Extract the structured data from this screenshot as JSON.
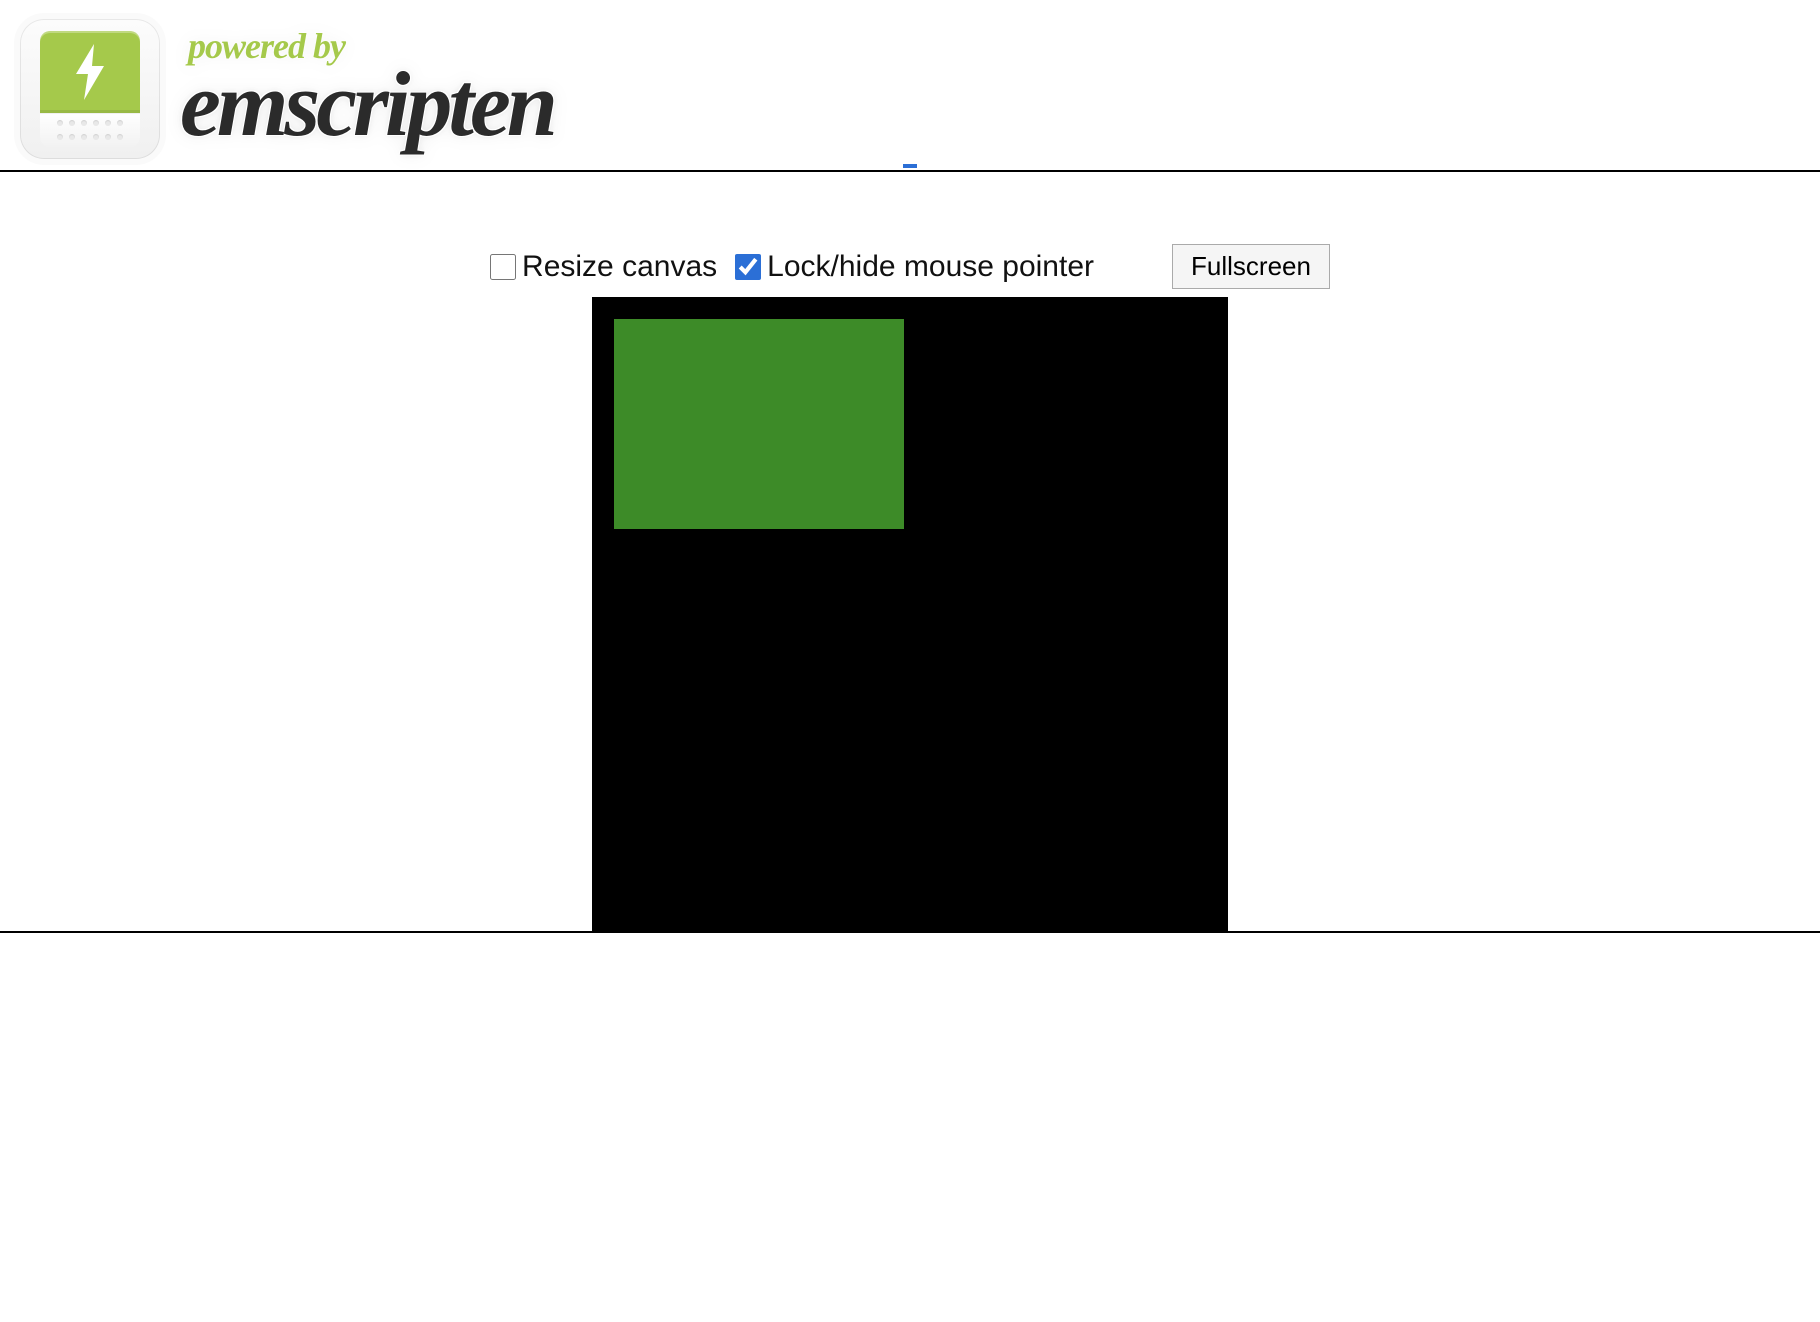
{
  "header": {
    "powered_by": "powered by",
    "brand": "emscripten",
    "logo_icon_name": "emscripten-bolt-logo"
  },
  "controls": {
    "resize_canvas": {
      "label": "Resize canvas",
      "checked": false
    },
    "lock_pointer": {
      "label": "Lock/hide mouse pointer",
      "checked": true
    },
    "fullscreen_label": "Fullscreen"
  },
  "canvas": {
    "background_color": "#000000",
    "rect": {
      "color": "#3d8b28"
    }
  }
}
